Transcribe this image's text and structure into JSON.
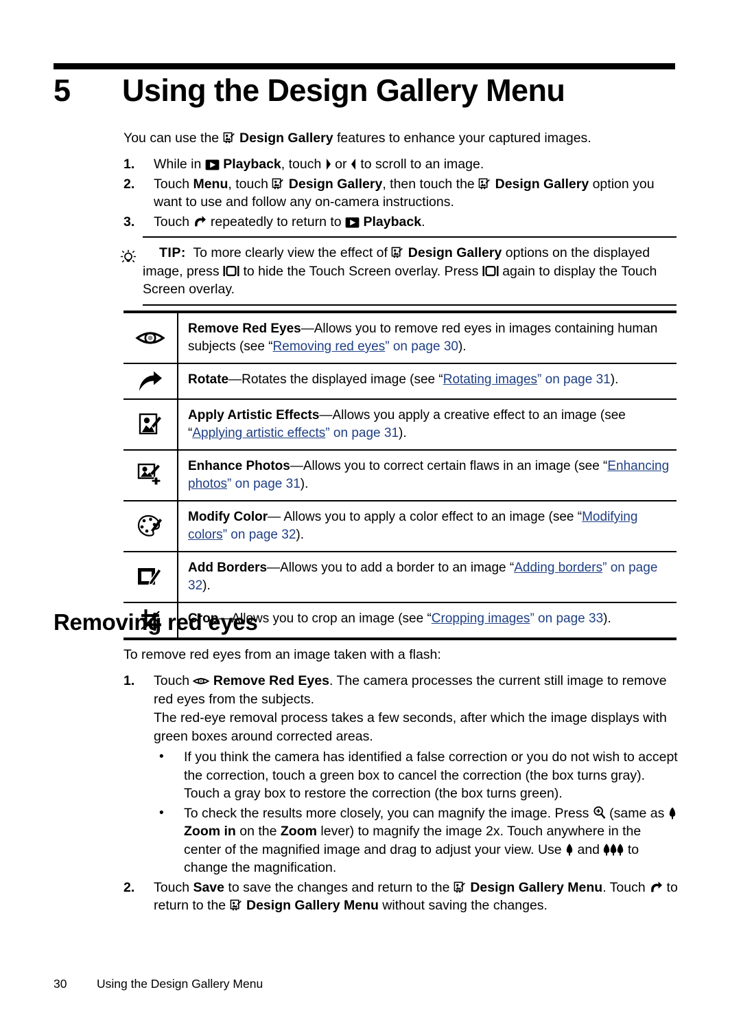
{
  "chapter": {
    "number": "5",
    "title": "Using the Design Gallery Menu"
  },
  "intro": {
    "before_icon": "You can use the ",
    "bold1": "Design Gallery",
    "after": " features to enhance your captured images."
  },
  "steps": [
    {
      "num": "1.",
      "t1": "While in ",
      "b1": "Playback",
      "t2": ", touch ",
      "t3": " or ",
      "t4": " to scroll to an image."
    },
    {
      "num": "2.",
      "t1": "Touch ",
      "b1": "Menu",
      "t2": ", touch ",
      "b2": "Design Gallery",
      "t3": ", then touch the ",
      "b3": "Design Gallery",
      "t4": " option you want to use and follow any on-camera instructions."
    },
    {
      "num": "3.",
      "t1": "Touch ",
      "t2": " repeatedly to return to ",
      "b1": "Playback",
      "t3": "."
    }
  ],
  "tip": {
    "label": "TIP:",
    "t1": "To more clearly view the effect of ",
    "b1": "Design Gallery",
    "t2": " options on the displayed image, press ",
    "t3": " to hide the Touch Screen overlay. Press ",
    "t4": " again to display the Touch Screen overlay."
  },
  "features": [
    {
      "icon": "eye-icon",
      "name": "Remove Red Eyes",
      "desc": "—Allows you to remove red eyes in images containing human subjects (see “",
      "link": "Removing red eyes",
      "tail_pre": "” on page ",
      "page": "30",
      "tail": ")."
    },
    {
      "icon": "rotate-arrow-icon",
      "name": "Rotate",
      "desc": "—Rotates the displayed image (see “",
      "link": "Rotating images",
      "tail_pre": "” on page ",
      "page": "31",
      "tail": ")."
    },
    {
      "icon": "artistic-effects-icon",
      "name": "Apply Artistic Effects",
      "desc": "—Allows you apply a creative effect to an image (see “",
      "link": "Applying artistic effects",
      "tail_pre": "” on page ",
      "page": "31",
      "tail": ")."
    },
    {
      "icon": "enhance-photos-icon",
      "name": "Enhance Photos",
      "desc": "—Allows you to correct certain flaws in an image (see “",
      "link": "Enhancing photos",
      "tail_pre": "” on page ",
      "page": "31",
      "tail": ")."
    },
    {
      "icon": "palette-icon",
      "name": "Modify Color",
      "desc": "— Allows you to apply a color effect to an image (see “",
      "link": "Modifying colors",
      "tail_pre": "” on page ",
      "page": "32",
      "tail": ")."
    },
    {
      "icon": "add-borders-icon",
      "name": "Add Borders",
      "desc": "—Allows you to add a border to an image “",
      "link": "Adding borders",
      "tail_pre": "” on page ",
      "page": "32",
      "tail": ")."
    },
    {
      "icon": "crop-icon",
      "name": "Crop",
      "desc": "—Allows you to crop an image (see “",
      "link": "Cropping images",
      "tail_pre": "” on page ",
      "page": "33",
      "tail": ")."
    }
  ],
  "section": {
    "heading": "Removing red eyes",
    "intro": "To remove red eyes from an image taken with a flash:",
    "step1": {
      "num": "1.",
      "t1": "Touch ",
      "b1": "Remove Red Eyes",
      "t2": ". The camera processes the current still image to remove red eyes from the subjects.",
      "para2": "The red-eye removal process takes a few seconds, after which the image displays with green boxes around corrected areas."
    },
    "bullets": [
      {
        "dot": "•",
        "text": "If you think the camera has identified a false correction or you do not wish to accept the correction, touch a green box to cancel the correction (the box turns gray). Touch a gray box to restore the correction (the box turns green)."
      },
      {
        "dot": "•",
        "t1": "To check the results more closely, you can magnify the image. Press ",
        "t2": " (same as ",
        "b1": "Zoom in",
        "t3": " on the ",
        "b2": "Zoom",
        "t4": " lever) to magnify the image 2x. Touch anywhere in the center of the magnified image and drag to adjust your view. Use ",
        "t5": " and ",
        "t6": " to change the magnification."
      }
    ],
    "step2": {
      "num": "2.",
      "t1": "Touch ",
      "b1": "Save",
      "t2": " to save the changes and return to the ",
      "b2": "Design Gallery Menu",
      "t3": ". Touch ",
      "t4": " to return to the ",
      "b3": "Design Gallery Menu",
      "t5": " without saving the changes."
    }
  },
  "footer": {
    "page_number": "30",
    "title": "Using the Design Gallery Menu"
  },
  "colors": {
    "link": "#1f3f84",
    "text": "#000000",
    "background": "#ffffff"
  }
}
